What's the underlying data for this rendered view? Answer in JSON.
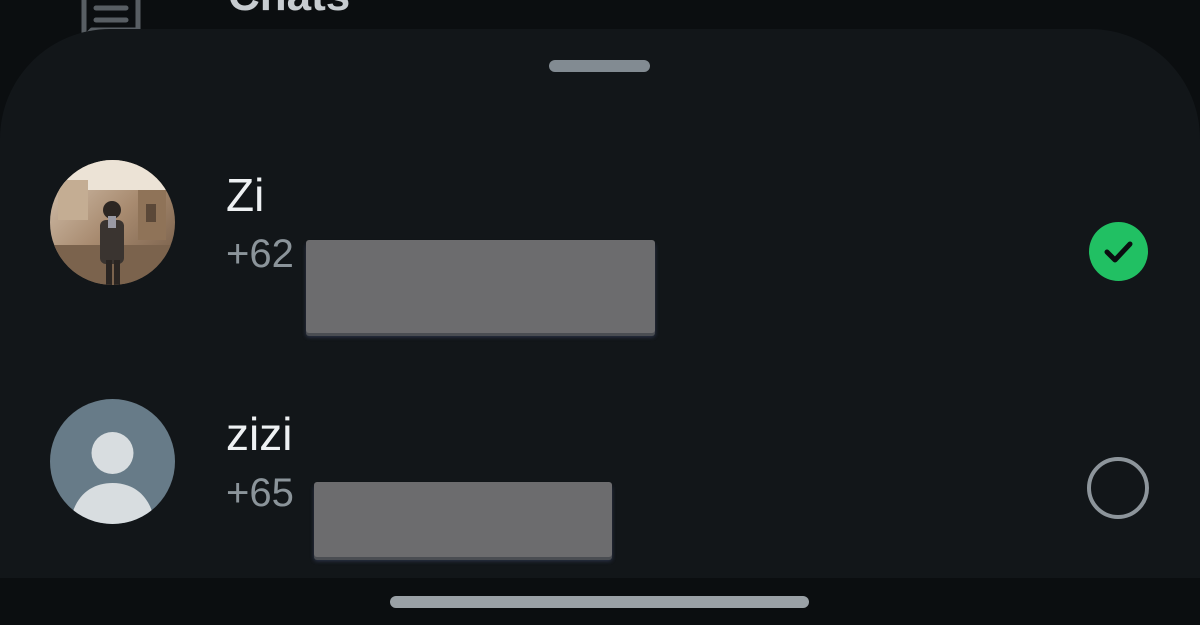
{
  "background_screen": {
    "label": "Chats",
    "icon": "chat-icon"
  },
  "sheet": {
    "contacts": [
      {
        "name": "Zi",
        "phone_visible": "+62",
        "avatar": "photo-avatar",
        "selected": true,
        "selection_icon": "checkmark-circle-icon"
      },
      {
        "name": "zizi",
        "phone_visible": "+65",
        "avatar": "default-person-avatar",
        "selected": false,
        "selection_icon": "empty-radio-circle-icon"
      }
    ]
  },
  "colors": {
    "sheet_background": "#121619",
    "accent_green": "#21c063",
    "name_text": "#eef1f3",
    "phone_text": "#8b949a",
    "redaction": "#6c6c6e"
  }
}
